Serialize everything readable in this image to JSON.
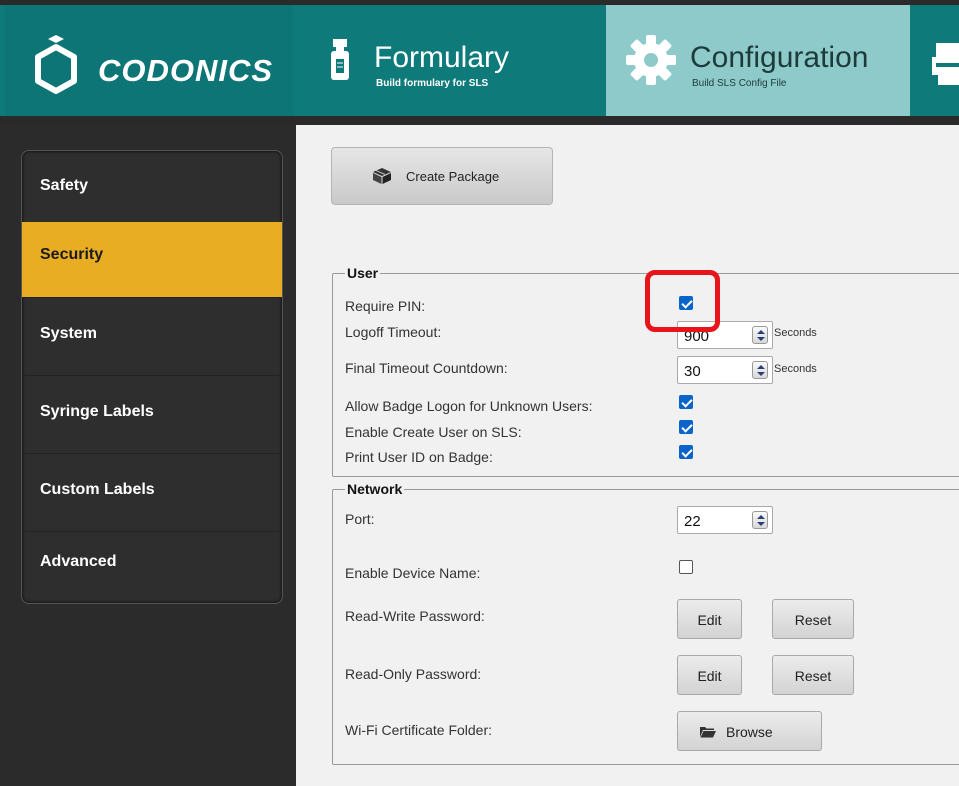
{
  "brand": {
    "name": "CODONICS"
  },
  "tabs": {
    "formulary": {
      "title": "Formulary",
      "subtitle": "Build formulary for SLS"
    },
    "configuration": {
      "title": "Configuration",
      "subtitle": "Build SLS Config File"
    }
  },
  "sidebar": {
    "items": [
      {
        "label": "Safety"
      },
      {
        "label": "Security"
      },
      {
        "label": "System"
      },
      {
        "label": "Syringe Labels"
      },
      {
        "label": "Custom Labels"
      },
      {
        "label": "Advanced"
      }
    ],
    "active": "Security"
  },
  "toolbar": {
    "create_package_label": "Create Package"
  },
  "user": {
    "legend": "User",
    "require_pin": {
      "label": "Require PIN:",
      "checked": true
    },
    "logoff_timeout": {
      "label": "Logoff Timeout:",
      "value": "900",
      "unit": "Seconds"
    },
    "final_timeout": {
      "label": "Final Timeout Countdown:",
      "value": "30",
      "unit": "Seconds"
    },
    "allow_badge": {
      "label": "Allow Badge Logon for Unknown Users:",
      "checked": true
    },
    "enable_create_user": {
      "label": "Enable Create User on SLS:",
      "checked": true
    },
    "print_user_id": {
      "label": "Print User ID on Badge:",
      "checked": true
    }
  },
  "network": {
    "legend": "Network",
    "port": {
      "label": "Port:",
      "value": "22"
    },
    "device_name": {
      "label": "Enable Device Name:",
      "checked": false
    },
    "rw_password": {
      "label": "Read-Write Password:",
      "edit": "Edit",
      "reset": "Reset"
    },
    "ro_password": {
      "label": "Read-Only Password:",
      "edit": "Edit",
      "reset": "Reset"
    },
    "wifi_cert": {
      "label": "Wi-Fi Certificate Folder:",
      "browse": "Browse"
    }
  },
  "colors": {
    "header_teal": "#0e7a7a",
    "active_tab": "#8fcaca",
    "sidebar_active": "#e8ad22",
    "checkbox_blue": "#0b64c9",
    "highlight_red": "#e8141c"
  },
  "icons": [
    "codonics-logo-icon",
    "bottle-icon",
    "gear-icon",
    "printer-icon",
    "box-icon",
    "folder-icon"
  ]
}
